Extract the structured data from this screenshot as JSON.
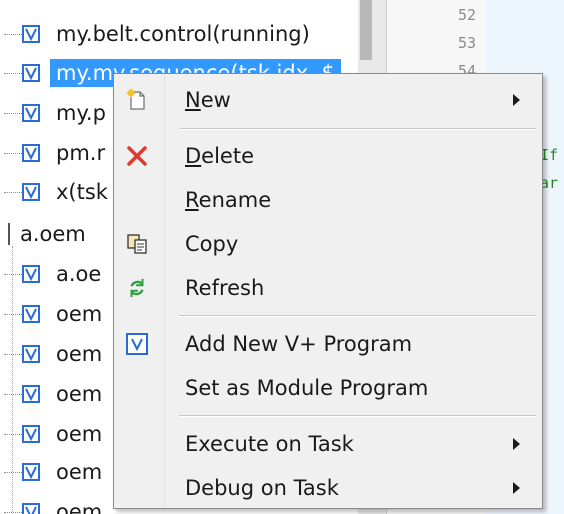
{
  "tree": {
    "items": [
      {
        "label": "my.belt.control(running)",
        "selected": false
      },
      {
        "label": "my.my.sequence(tsk.idx, $",
        "selected": true
      },
      {
        "label": "my.p",
        "selected": false
      },
      {
        "label": "pm.r",
        "selected": false
      },
      {
        "label": "x(tsk",
        "selected": false
      }
    ],
    "folder": {
      "label": "a.oem"
    },
    "children": [
      {
        "label": "a.oe"
      },
      {
        "label": "oem"
      },
      {
        "label": "oem"
      },
      {
        "label": "oem"
      },
      {
        "label": "oem"
      },
      {
        "label": "oem"
      },
      {
        "label": "oem"
      }
    ]
  },
  "editor": {
    "line_numbers": [
      "52",
      "53",
      "54"
    ],
    "fragments": [
      "If",
      "ar"
    ]
  },
  "context_menu": {
    "items": [
      {
        "label": "New",
        "accel": "N",
        "rest": "ew",
        "icon": "new-document-icon",
        "submenu": true
      },
      {
        "label": "Delete",
        "accel": "D",
        "rest": "elete",
        "icon": "delete-x-icon",
        "submenu": false
      },
      {
        "label": "Rename",
        "accel": "R",
        "rest": "ename",
        "icon": "",
        "submenu": false
      },
      {
        "label": "Copy",
        "icon": "copy-icon",
        "submenu": false
      },
      {
        "label": "Refresh",
        "icon": "refresh-icon",
        "submenu": false
      },
      {
        "label": "Add New V+ Program",
        "icon": "vplus-program-icon",
        "submenu": false
      },
      {
        "label": "Set as Module Program",
        "icon": "",
        "submenu": false
      },
      {
        "label": "Execute on Task",
        "icon": "",
        "submenu": true
      },
      {
        "label": "Debug on Task",
        "icon": "",
        "submenu": true
      }
    ]
  },
  "colors": {
    "selection": "#3399ff",
    "v_icon": "#2b6bd6",
    "delete_icon": "#e0392b",
    "refresh_icon": "#2ea043",
    "code_comment": "#1f8a1f"
  }
}
